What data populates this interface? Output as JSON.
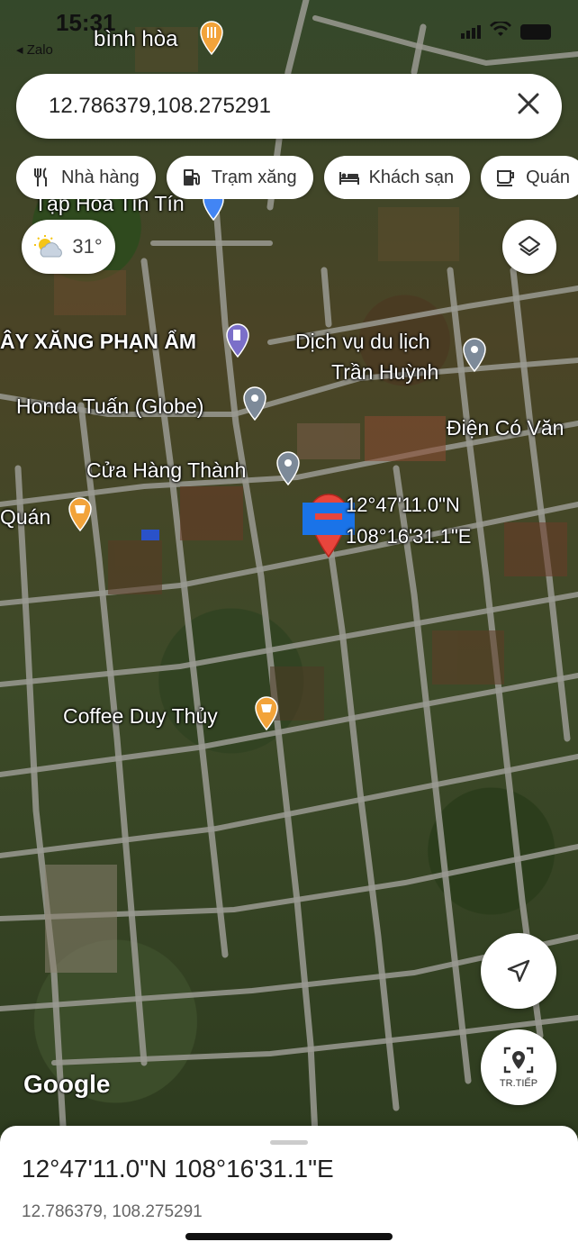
{
  "status_bar": {
    "time": "15:31",
    "back_app": "◂ Zalo"
  },
  "search": {
    "query": "12.786379,108.275291"
  },
  "chips": [
    {
      "label": "Nhà hàng",
      "icon": "restaurant-icon"
    },
    {
      "label": "Trạm xăng",
      "icon": "gas-station-icon"
    },
    {
      "label": "Khách sạn",
      "icon": "hotel-icon"
    },
    {
      "label": "Quán",
      "icon": "coffee-icon"
    }
  ],
  "weather": {
    "temp": "31°",
    "icon": "partly-sunny-icon"
  },
  "map_labels": {
    "place_top": "bình hòa",
    "tap_hoa": "Tạp Hóa Tín Tín",
    "cay_xang": "ÂY XĂNG PHẠN ẨM",
    "dich_vu_1": "Dịch vụ du lịch",
    "dich_vu_2": "Trần Huỳnh",
    "honda": "Honda Tuấn (Globe)",
    "dien_co": "Điện Có Văn",
    "cua_hang": "Cửa Hàng Thành",
    "quan": "Quán",
    "coord_1": "12°47'11.0\"N",
    "coord_2": "108°16'31.1\"E",
    "coffee": "Coffee Duy Thủy"
  },
  "map_brand": "Google",
  "buttons": {
    "start_label": "TR.TIẾP"
  },
  "sheet": {
    "title": "12°47'11.0\"N 108°16'31.1\"E",
    "subtitle": "12.786379, 108.275291"
  },
  "colors": {
    "pin_red": "#e8453c",
    "poi_orange": "#f2a33a",
    "poi_gray": "#7d8a99",
    "poi_purple": "#7b6fc9",
    "pin_label_blue": "#1a73e8"
  }
}
